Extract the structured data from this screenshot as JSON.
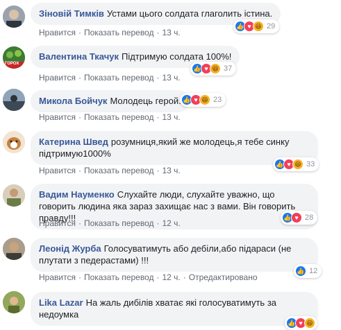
{
  "comments": [
    {
      "author": "Зіновій Тимків",
      "text": "Устами цього солдата глаголить істина.",
      "time": "13 ч.",
      "reactions": [
        "like",
        "love",
        "haha"
      ],
      "count": "29"
    },
    {
      "author": "Валентина Ткачук",
      "text": "Підтримую солдата 100%!",
      "time": "13 ч.",
      "reactions": [
        "like",
        "love",
        "haha"
      ],
      "count": "37"
    },
    {
      "author": "Микола Бойчук",
      "text": "Молодець герой.",
      "time": "13 ч.",
      "reactions": [
        "like",
        "love",
        "haha"
      ],
      "count": "23"
    },
    {
      "author": "Катерина Швед",
      "text": "розумниця,який же молодець,я тебе синку підтримую1000%",
      "time": "13 ч.",
      "reactions": [
        "like",
        "love",
        "haha"
      ],
      "count": "33"
    },
    {
      "author": "Вадим Науменко",
      "text": "Слухайте люди, слухайте уважно, що говорить людина яка зараз захищає нас з вами. Він говорить правду!!!",
      "time": "12 ч.",
      "reactions": [
        "like",
        "love"
      ],
      "count": "28"
    },
    {
      "author": "Леонід Журба",
      "text": "Голосуватимуть або дебіли,або підараси (не плутати з педерастами) !!!",
      "time": "12 ч.",
      "edited": "Отредактировано",
      "reactions": [
        "like"
      ],
      "count": "12"
    },
    {
      "author": "Lika Lazar",
      "text": "На жаль дибілів хватає які голосуватимуть за недоумка",
      "reactions": [
        "like",
        "love",
        "haha"
      ]
    }
  ],
  "labels": {
    "reply": "Нравится",
    "translate": "Показать перевод",
    "dot": "·"
  },
  "avatar_badge": "ГОРОХ"
}
